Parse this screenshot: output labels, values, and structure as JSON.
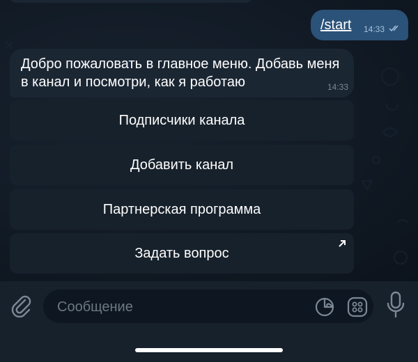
{
  "messages": {
    "outgoing": {
      "text": "/start",
      "time": "14:33",
      "status_icon": "double-check-icon"
    },
    "incoming": {
      "text": "Добро пожаловать в главное меню. Добавь меня в канал и посмотри, как я работаю",
      "time": "14:33"
    }
  },
  "keyboard": {
    "buttons": [
      {
        "label": "Подписчики канала"
      },
      {
        "label": "Добавить канал"
      },
      {
        "label": "Партнерская программа"
      },
      {
        "label": "Задать вопрос",
        "icon": "external-link-arrow-icon"
      }
    ]
  },
  "composer": {
    "placeholder": "Сообщение",
    "value": "",
    "icons": [
      "paperclip-icon",
      "sticker-icon",
      "emoji-keyboard-icon",
      "microphone-icon"
    ]
  },
  "colors": {
    "chat_background": "#0e1621",
    "outgoing_bubble": "#2b5278",
    "incoming_bubble": "#1b2633",
    "keyboard_button": "#17212b",
    "icon_gray": "#7b8896"
  }
}
